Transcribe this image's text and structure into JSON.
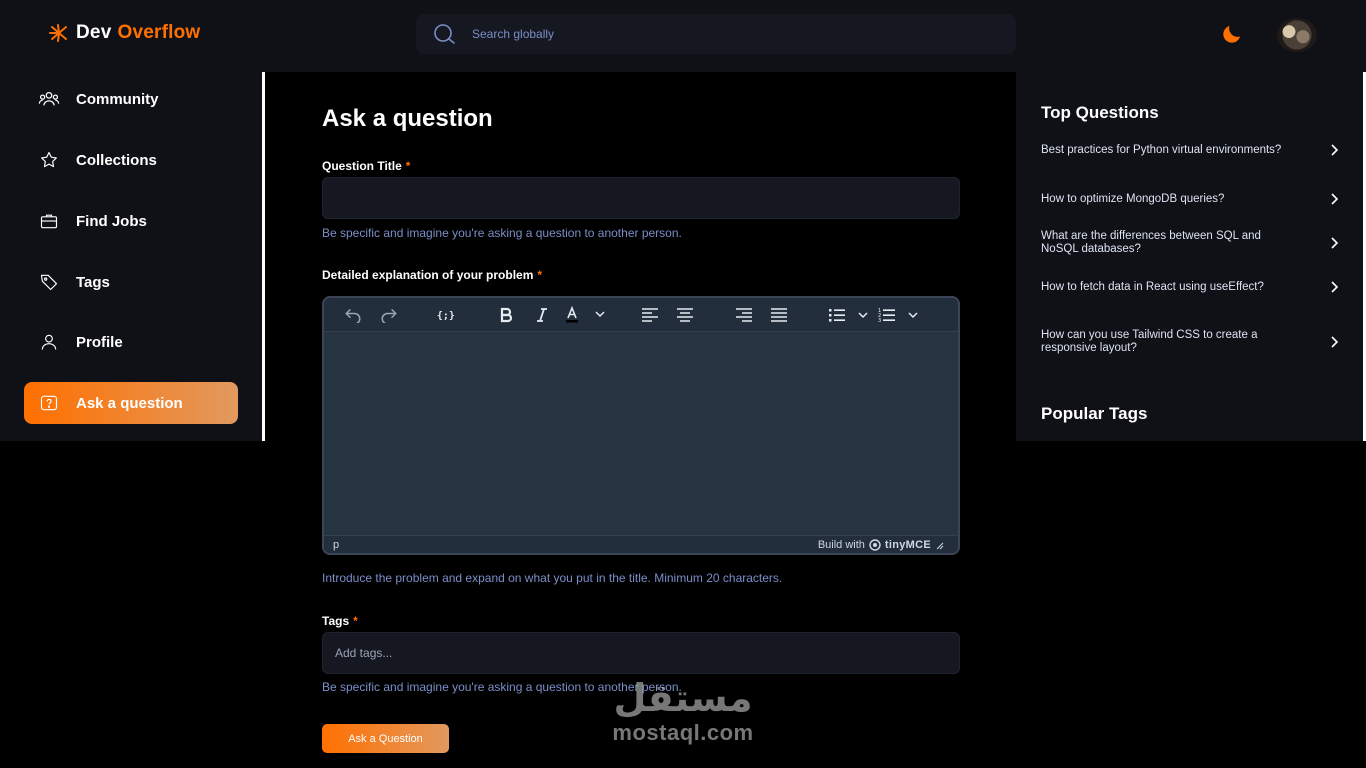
{
  "header": {
    "logo_part1": "Dev",
    "logo_part2": "Overflow",
    "search_placeholder": "Search globally"
  },
  "sidebar": {
    "items": [
      {
        "label": "Community",
        "icon": "users-icon"
      },
      {
        "label": "Collections",
        "icon": "star-icon"
      },
      {
        "label": "Find Jobs",
        "icon": "briefcase-icon"
      },
      {
        "label": "Tags",
        "icon": "tag-icon"
      },
      {
        "label": "Profile",
        "icon": "user-icon"
      },
      {
        "label": "Ask a question",
        "icon": "question-icon",
        "active": true
      }
    ]
  },
  "main": {
    "title": "Ask a question",
    "question_title_label": "Question Title",
    "required_mark": "*",
    "question_title_value": "",
    "question_title_hint": "Be specific and imagine you're asking a question to another person.",
    "explanation_label": "Detailed explanation of your problem",
    "editor": {
      "status_element": "p",
      "brand_prefix": "Build with",
      "brand_name": "tinyMCE",
      "toolbar": [
        "undo-icon",
        "redo-icon",
        "code-sample-icon",
        "bold-icon",
        "italic-icon",
        "text-color-icon",
        "align-left-icon",
        "align-center-icon",
        "align-right-icon",
        "justify-icon",
        "bullet-list-icon",
        "numbered-list-icon"
      ]
    },
    "explanation_hint": "Introduce the problem and expand on what you put in the title. Minimum 20 characters.",
    "tags_label": "Tags",
    "tags_placeholder": "Add tags...",
    "tags_hint": "Be specific and imagine you're asking a question to another person.",
    "submit_label": "Ask a Question"
  },
  "right_sidebar": {
    "top_questions_title": "Top Questions",
    "top_questions": [
      "Best practices for Python virtual environments?",
      "How to optimize MongoDB queries?",
      "What are the differences between SQL and NoSQL databases?",
      "How to fetch data in React using useEffect?",
      "How can you use Tailwind CSS to create a responsive layout?"
    ],
    "popular_tags_title": "Popular Tags"
  },
  "watermark": {
    "arabic": "مستقل",
    "latin": "mostaql.com"
  },
  "colors": {
    "accent": "#ff7000",
    "background": "#000000",
    "panel": "#0f1117",
    "hint": "#7b8ec8"
  }
}
